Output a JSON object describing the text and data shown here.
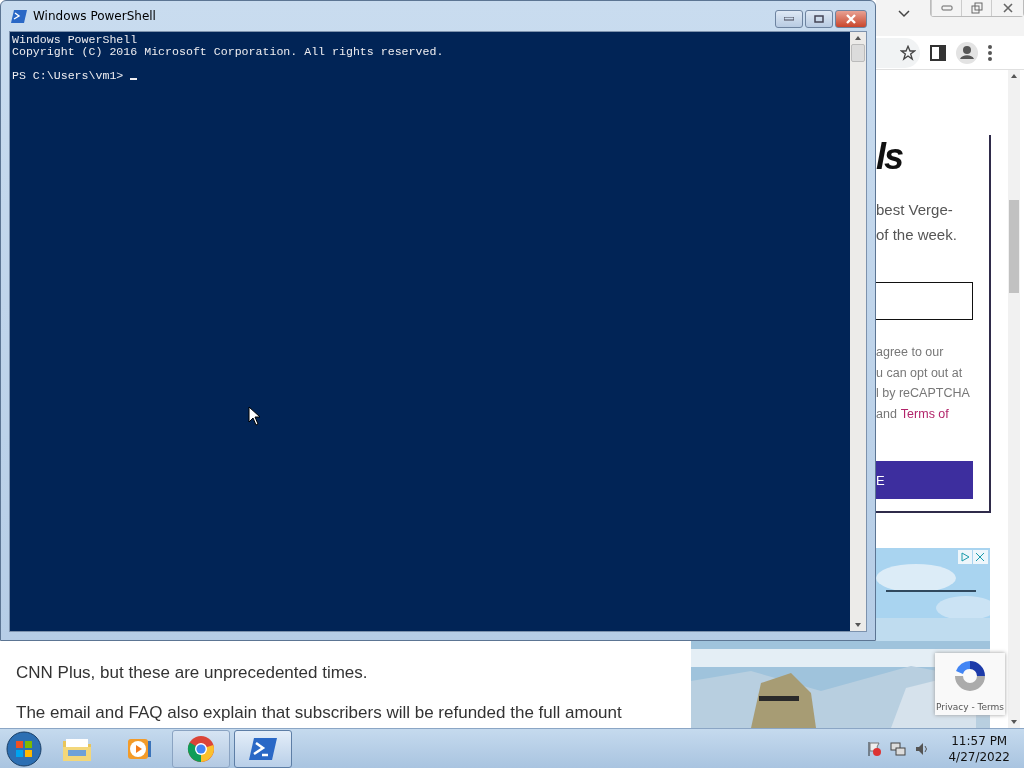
{
  "powershell": {
    "title": "Windows PowerShell",
    "output": [
      "Windows PowerShell",
      "Copyright (C) 2016 Microsoft Corporation. All rights reserved."
    ],
    "prompt": "PS C:\\Users\\vm1>"
  },
  "browser": {
    "newsletter": {
      "logo": "ls",
      "intro": [
        "best Verge-",
        "of the week."
      ],
      "consent": [
        {
          "text": "agree to our"
        },
        {
          "text": "u can opt out at"
        },
        {
          "text": "l by reCAPTCHA"
        },
        {
          "text": "and",
          "link": "Terms of"
        }
      ],
      "button": "E"
    },
    "article": {
      "paragraphs": [
        "CNN Plus, but these are unprecedented times.",
        "The email and FAQ also explain that subscribers will be refunded the full amount"
      ]
    },
    "recaptcha": {
      "links": "Privacy - Terms"
    }
  },
  "taskbar": {
    "apps": [
      {
        "kind": "explorer",
        "running": false,
        "selected": false
      },
      {
        "kind": "media",
        "running": false,
        "selected": false
      },
      {
        "kind": "chrome",
        "running": true,
        "selected": false
      },
      {
        "kind": "powershell",
        "running": true,
        "selected": true
      }
    ],
    "clock": {
      "time": "11:57 PM",
      "date": "4/27/2022"
    }
  }
}
